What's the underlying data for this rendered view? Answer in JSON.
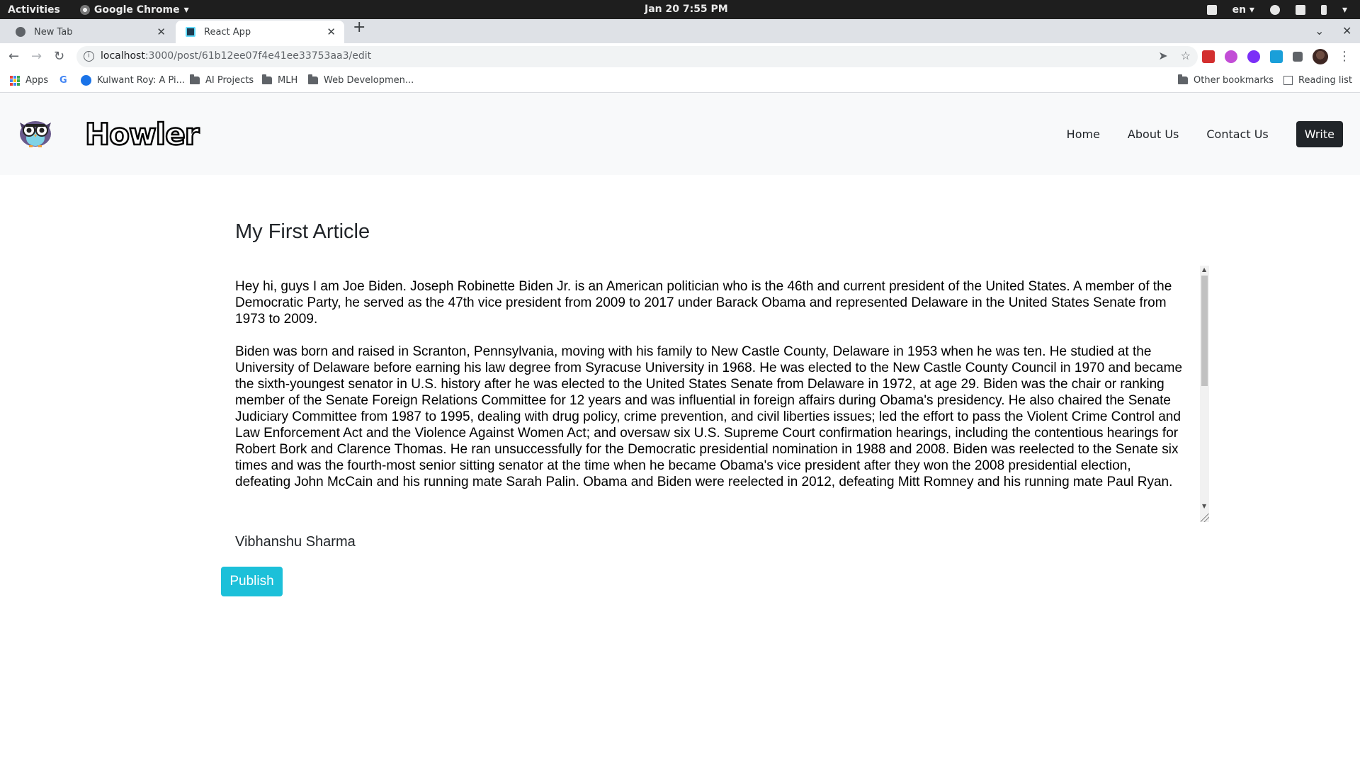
{
  "system_bar": {
    "activities": "Activities",
    "app_name": "Google Chrome",
    "datetime": "Jan 20  7:55 PM",
    "language": "en"
  },
  "browser": {
    "tabs": [
      {
        "title": "New Tab",
        "active": false
      },
      {
        "title": "React App",
        "active": true
      }
    ],
    "url": {
      "host": "localhost",
      "path": ":3000/post/61b12ee07f4e41ee33753aa3/edit"
    },
    "bookmarks": [
      {
        "label": "Apps",
        "icon": "apps-grid-icon"
      },
      {
        "label": "",
        "icon": "google-icon"
      },
      {
        "label": "Kulwant Roy: A Pi...",
        "icon": "site-icon"
      },
      {
        "label": "AI Projects",
        "icon": "folder-icon"
      },
      {
        "label": "MLH",
        "icon": "folder-icon"
      },
      {
        "label": "Web Developmen...",
        "icon": "folder-icon"
      }
    ],
    "other_bookmarks": "Other bookmarks",
    "reading_list": "Reading list"
  },
  "site": {
    "brand": "Howler",
    "nav": {
      "home": "Home",
      "about": "About Us",
      "contact": "Contact Us",
      "write": "Write"
    }
  },
  "article": {
    "title": "My First Article",
    "paragraphs": [
      "Hey hi, guys I am Joe Biden. Joseph Robinette Biden Jr. is an American politician who is the 46th and current president of the United States. A member of the Democratic Party, he served as the 47th vice president from 2009 to 2017 under Barack Obama and represented Delaware in the United States Senate from 1973 to 2009.",
      "Biden was born and raised in Scranton, Pennsylvania, moving with his family to New Castle County, Delaware in 1953 when he was ten. He studied at the University of Delaware before earning his law degree from Syracuse University in 1968. He was elected to the New Castle County Council in 1970 and became the sixth-youngest senator in U.S. history after he was elected to the United States Senate from Delaware in 1972, at age 29. Biden was the chair or ranking member of the Senate Foreign Relations Committee for 12 years and was influential in foreign affairs during Obama's presidency. He also chaired the Senate Judiciary Committee from 1987 to 1995, dealing with drug policy, crime prevention, and civil liberties issues; led the effort to pass the Violent Crime Control and Law Enforcement Act and the Violence Against Women Act; and oversaw six U.S. Supreme Court confirmation hearings, including the contentious hearings for Robert Bork and Clarence Thomas. He ran unsuccessfully for the Democratic presidential nomination in 1988 and 2008. Biden was reelected to the Senate six times and was the fourth-most senior sitting senator at the time when he became Obama's vice president after they won the 2008 presidential election, defeating John McCain and his running mate Sarah Palin. Obama and Biden were reelected in 2012, defeating Mitt Romney and his running mate Paul Ryan."
    ],
    "author": "Vibhanshu Sharma",
    "publish_label": "Publish"
  },
  "colors": {
    "publish": "#1cc0d9",
    "write": "#212529",
    "navbar_bg": "#f8f9fa"
  }
}
